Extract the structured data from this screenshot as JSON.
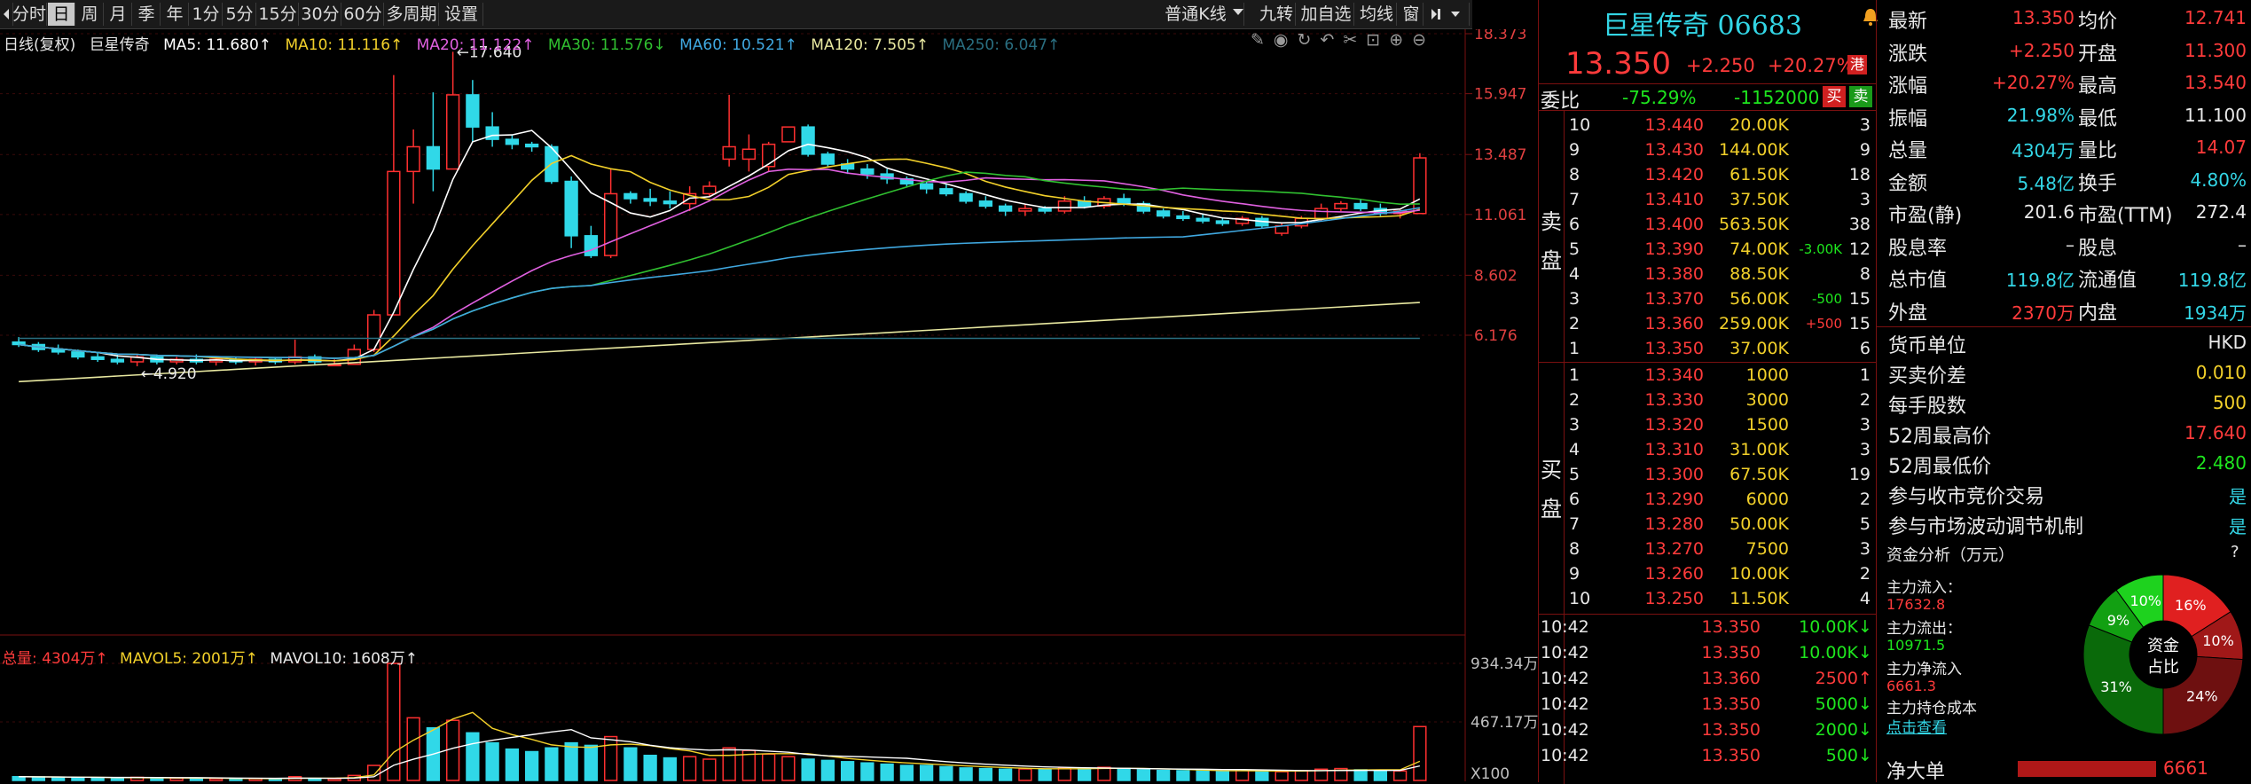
{
  "toolbar": {
    "tabs": [
      "分时",
      "日",
      "周",
      "月",
      "季",
      "年",
      "1分",
      "5分",
      "15分",
      "30分",
      "60分",
      "多周期",
      "设置"
    ],
    "active_tab": "日",
    "kline_type": "普通K线",
    "btn_jiuzhuan": "九转",
    "btn_add_watch": "加自选",
    "btn_ma": "均线",
    "btn_window": "窗"
  },
  "legend": {
    "prefix": "日线(复权)",
    "stock": "巨星传奇",
    "ma5": "MA5: 11.680↑",
    "ma10": "MA10: 11.116↑",
    "ma20": "MA20: 11.122↑",
    "ma30": "MA30: 11.576↓",
    "ma60": "MA60: 10.521↑",
    "ma120": "MA120: 7.505↑",
    "ma250": "MA250: 6.047↑"
  },
  "price_axis": [
    "18.373",
    "15.947",
    "13.487",
    "11.061",
    "8.602",
    "6.176"
  ],
  "annotations": {
    "high": "17.640",
    "low": "4.920"
  },
  "volume_legend": {
    "total": "总量: 4304万↑",
    "mavol5": "MAVOL5: 2001万↑",
    "mavol10": "MAVOL10: 1608万↑"
  },
  "volume_axis": [
    "934.34万",
    "467.17万",
    "X100"
  ],
  "chart_data": {
    "type": "candlestick",
    "candles": [
      [
        5.9,
        6.1,
        5.7,
        5.8
      ],
      [
        5.8,
        5.9,
        5.5,
        5.6
      ],
      [
        5.6,
        5.8,
        5.4,
        5.5
      ],
      [
        5.5,
        5.6,
        5.2,
        5.3
      ],
      [
        5.3,
        5.5,
        5.1,
        5.2
      ],
      [
        5.2,
        5.4,
        5.0,
        5.1
      ],
      [
        5.1,
        5.4,
        4.92,
        5.3
      ],
      [
        5.3,
        5.4,
        5.0,
        5.1
      ],
      [
        5.1,
        5.3,
        5.0,
        5.2
      ],
      [
        5.2,
        5.4,
        5.0,
        5.1
      ],
      [
        5.1,
        5.3,
        4.95,
        5.2
      ],
      [
        5.2,
        5.3,
        5.0,
        5.1
      ],
      [
        5.1,
        5.3,
        4.95,
        5.2
      ],
      [
        5.2,
        5.3,
        5.0,
        5.1
      ],
      [
        5.1,
        6.0,
        5.0,
        5.3
      ],
      [
        5.3,
        5.4,
        5.0,
        5.1
      ],
      [
        5.0,
        5.2,
        4.95,
        5.0
      ],
      [
        5.0,
        5.8,
        5.0,
        5.6
      ],
      [
        5.6,
        7.2,
        5.5,
        7.0
      ],
      [
        7.0,
        16.7,
        7.0,
        12.8
      ],
      [
        12.8,
        14.5,
        11.5,
        13.8
      ],
      [
        13.8,
        16.0,
        12.0,
        12.9
      ],
      [
        12.9,
        17.64,
        13.0,
        15.9
      ],
      [
        15.9,
        16.5,
        14.0,
        14.6
      ],
      [
        14.6,
        15.2,
        13.8,
        14.1
      ],
      [
        14.1,
        14.3,
        13.7,
        13.9
      ],
      [
        13.9,
        14.0,
        13.6,
        13.8
      ],
      [
        13.8,
        13.9,
        12.3,
        12.4
      ],
      [
        12.4,
        12.6,
        9.7,
        10.2
      ],
      [
        10.2,
        10.6,
        9.3,
        9.4
      ],
      [
        9.4,
        12.9,
        9.3,
        11.9
      ],
      [
        11.9,
        12.0,
        11.5,
        11.7
      ],
      [
        11.7,
        12.1,
        11.4,
        11.6
      ],
      [
        11.6,
        12.0,
        11.3,
        11.5
      ],
      [
        11.5,
        12.2,
        11.2,
        11.9
      ],
      [
        11.9,
        12.4,
        11.8,
        12.2
      ],
      [
        13.3,
        15.9,
        13.0,
        13.8
      ],
      [
        13.3,
        14.3,
        12.8,
        13.7
      ],
      [
        13.0,
        14.0,
        12.8,
        13.9
      ],
      [
        14.0,
        14.3,
        14.0,
        14.6
      ],
      [
        14.6,
        14.7,
        13.4,
        13.5
      ],
      [
        13.5,
        13.6,
        13.0,
        13.1
      ],
      [
        13.1,
        13.3,
        12.7,
        12.9
      ],
      [
        12.9,
        13.1,
        12.5,
        12.7
      ],
      [
        12.7,
        12.9,
        12.3,
        12.5
      ],
      [
        12.5,
        12.6,
        12.2,
        12.3
      ],
      [
        12.3,
        12.4,
        11.9,
        12.1
      ],
      [
        12.1,
        12.3,
        11.8,
        11.9
      ],
      [
        11.9,
        12.0,
        11.5,
        11.6
      ],
      [
        11.6,
        11.8,
        11.3,
        11.4
      ],
      [
        11.4,
        11.5,
        11.0,
        11.2
      ],
      [
        11.2,
        11.5,
        11.0,
        11.3
      ],
      [
        11.3,
        11.4,
        11.1,
        11.2
      ],
      [
        11.2,
        11.8,
        11.1,
        11.6
      ],
      [
        11.6,
        11.8,
        11.3,
        11.4
      ],
      [
        11.4,
        11.8,
        11.3,
        11.7
      ],
      [
        11.7,
        11.9,
        11.4,
        11.5
      ],
      [
        11.5,
        11.6,
        11.1,
        11.2
      ],
      [
        11.2,
        11.3,
        10.9,
        11.0
      ],
      [
        11.0,
        11.2,
        10.8,
        10.9
      ],
      [
        10.9,
        11.1,
        10.7,
        10.8
      ],
      [
        10.8,
        10.9,
        10.6,
        10.7
      ],
      [
        10.7,
        11.0,
        10.6,
        10.9
      ],
      [
        10.9,
        11.0,
        10.5,
        10.6
      ],
      [
        10.3,
        10.7,
        10.2,
        10.6
      ],
      [
        10.6,
        11.0,
        10.5,
        10.9
      ],
      [
        10.9,
        11.5,
        10.8,
        11.3
      ],
      [
        11.3,
        11.6,
        11.2,
        11.5
      ],
      [
        11.5,
        11.7,
        11.2,
        11.3
      ],
      [
        11.3,
        11.5,
        11.0,
        11.1
      ],
      [
        11.1,
        11.3,
        10.9,
        11.2
      ],
      [
        11.1,
        13.54,
        11.1,
        13.35
      ]
    ],
    "volume": [
      30,
      28,
      25,
      22,
      20,
      18,
      25,
      20,
      18,
      16,
      15,
      14,
      15,
      14,
      30,
      16,
      14,
      40,
      120,
      934,
      500,
      420,
      480,
      380,
      300,
      250,
      230,
      260,
      300,
      280,
      350,
      260,
      200,
      180,
      190,
      170,
      260,
      240,
      210,
      190,
      170,
      160,
      150,
      140,
      130,
      120,
      120,
      110,
      100,
      95,
      90,
      92,
      88,
      100,
      95,
      105,
      96,
      85,
      80,
      78,
      76,
      72,
      80,
      75,
      70,
      78,
      90,
      95,
      85,
      80,
      76,
      430
    ]
  },
  "header": {
    "name": "巨星传奇",
    "code": "06683",
    "price": "13.350",
    "change": "+2.250",
    "pct": "+20.27%",
    "hk_badge": "港"
  },
  "weibi": {
    "label": "委比",
    "ratio": "-75.29%",
    "diff": "-1152000",
    "buy": "买",
    "sell": "卖"
  },
  "ask_side_label": [
    "卖",
    "盘"
  ],
  "bid_side_label": [
    "买",
    "盘"
  ],
  "asks": [
    {
      "lvl": "10",
      "price": "13.440",
      "vol": "20.00K",
      "chg": "",
      "cnt": "3"
    },
    {
      "lvl": "9",
      "price": "13.430",
      "vol": "144.00K",
      "chg": "",
      "cnt": "9"
    },
    {
      "lvl": "8",
      "price": "13.420",
      "vol": "61.50K",
      "chg": "",
      "cnt": "18"
    },
    {
      "lvl": "7",
      "price": "13.410",
      "vol": "37.50K",
      "chg": "",
      "cnt": "3"
    },
    {
      "lvl": "6",
      "price": "13.400",
      "vol": "563.50K",
      "chg": "",
      "cnt": "38"
    },
    {
      "lvl": "5",
      "price": "13.390",
      "vol": "74.00K",
      "chg": "-3.00K",
      "cnt": "12"
    },
    {
      "lvl": "4",
      "price": "13.380",
      "vol": "88.50K",
      "chg": "",
      "cnt": "8"
    },
    {
      "lvl": "3",
      "price": "13.370",
      "vol": "56.00K",
      "chg": "-500",
      "cnt": "15"
    },
    {
      "lvl": "2",
      "price": "13.360",
      "vol": "259.00K",
      "chg": "+500",
      "cnt": "15"
    },
    {
      "lvl": "1",
      "price": "13.350",
      "vol": "37.00K",
      "chg": "",
      "cnt": "6"
    }
  ],
  "bids": [
    {
      "lvl": "1",
      "price": "13.340",
      "vol": "1000",
      "cnt": "1"
    },
    {
      "lvl": "2",
      "price": "13.330",
      "vol": "3000",
      "cnt": "2"
    },
    {
      "lvl": "3",
      "price": "13.320",
      "vol": "1500",
      "cnt": "3"
    },
    {
      "lvl": "4",
      "price": "13.310",
      "vol": "31.00K",
      "cnt": "3"
    },
    {
      "lvl": "5",
      "price": "13.300",
      "vol": "67.50K",
      "cnt": "19"
    },
    {
      "lvl": "6",
      "price": "13.290",
      "vol": "6000",
      "cnt": "2"
    },
    {
      "lvl": "7",
      "price": "13.280",
      "vol": "50.00K",
      "cnt": "5"
    },
    {
      "lvl": "8",
      "price": "13.270",
      "vol": "7500",
      "cnt": "3"
    },
    {
      "lvl": "9",
      "price": "13.260",
      "vol": "10.00K",
      "cnt": "2"
    },
    {
      "lvl": "10",
      "price": "13.250",
      "vol": "11.50K",
      "cnt": "4"
    }
  ],
  "trades": [
    {
      "t": "10:42",
      "p": "13.350",
      "v": "10.00K",
      "d": "↓"
    },
    {
      "t": "10:42",
      "p": "13.350",
      "v": "10.00K",
      "d": "↓"
    },
    {
      "t": "10:42",
      "p": "13.360",
      "v": "2500",
      "d": "↑"
    },
    {
      "t": "10:42",
      "p": "13.350",
      "v": "5000",
      "d": "↓"
    },
    {
      "t": "10:42",
      "p": "13.350",
      "v": "2000",
      "d": "↓"
    },
    {
      "t": "10:42",
      "p": "13.350",
      "v": "500",
      "d": "↓"
    }
  ],
  "quote": [
    {
      "l1": "最新",
      "v1": "13.350",
      "c1": "red",
      "l2": "均价",
      "v2": "12.741",
      "c2": "red"
    },
    {
      "l1": "涨跌",
      "v1": "+2.250",
      "c1": "red",
      "l2": "开盘",
      "v2": "11.300",
      "c2": "red"
    },
    {
      "l1": "涨幅",
      "v1": "+20.27%",
      "c1": "red",
      "l2": "最高",
      "v2": "13.540",
      "c2": "red"
    },
    {
      "l1": "振幅",
      "v1": "21.98%",
      "c1": "cyan",
      "l2": "最低",
      "v2": "11.100",
      "c2": "white"
    },
    {
      "l1": "总量",
      "v1": "4304万",
      "c1": "cyan",
      "l2": "量比",
      "v2": "14.07",
      "c2": "red"
    },
    {
      "l1": "金额",
      "v1": "5.48亿",
      "c1": "cyan",
      "l2": "换手",
      "v2": "4.80%",
      "c2": "cyan"
    },
    {
      "l1": "市盈(静)",
      "v1": "201.6",
      "c1": "white",
      "l2": "市盈(TTM)",
      "v2": "272.4",
      "c2": "white"
    },
    {
      "l1": "股息率",
      "v1": "–",
      "c1": "white",
      "l2": "股息",
      "v2": "–",
      "c2": "white"
    },
    {
      "l1": "总市值",
      "v1": "119.8亿",
      "c1": "cyan",
      "l2": "流通值",
      "v2": "119.8亿",
      "c2": "cyan"
    },
    {
      "l1": "外盘",
      "v1": "2370万",
      "c1": "red",
      "l2": "内盘",
      "v2": "1934万",
      "c2": "cyan"
    }
  ],
  "info": [
    {
      "l": "货币单位",
      "v": "HKD",
      "c": "white"
    },
    {
      "l": "买卖价差",
      "v": "0.010",
      "c": "yellow"
    },
    {
      "l": "每手股数",
      "v": "500",
      "c": "yellow"
    },
    {
      "l": "52周最高价",
      "v": "17.640",
      "c": "red"
    },
    {
      "l": "52周最低价",
      "v": "2.480",
      "c": "green"
    },
    {
      "l": "参与收市竞价交易",
      "v": "是",
      "c": "cyan"
    },
    {
      "l": "参与市场波动调节机制",
      "v": "是",
      "c": "cyan"
    }
  ],
  "fund": {
    "title": "资金分析（万元）",
    "help": "?",
    "in_label": "主力流入：",
    "in_val": "17632.8",
    "out_label": "主力流出：",
    "out_val": "10971.5",
    "net_label": "主力净流入",
    "net_val": "6661.3",
    "cost_label": "主力持仓成本",
    "cost_link": "点击查看",
    "donut_center1": "资金",
    "donut_center2": "占比",
    "slices": [
      {
        "label": "16%",
        "value": 16,
        "color": "#e02020"
      },
      {
        "label": "10%",
        "value": 10,
        "color": "#a01818"
      },
      {
        "label": "24%",
        "value": 24,
        "color": "#6e1010"
      },
      {
        "label": "31%",
        "value": 31,
        "color": "#0a6a0a"
      },
      {
        "label": "9%",
        "value": 9,
        "color": "#12a012"
      },
      {
        "label": "10%",
        "value": 10,
        "color": "#1ed21e"
      }
    ],
    "bottom_label": "净大单",
    "bottom_val": "6661"
  }
}
